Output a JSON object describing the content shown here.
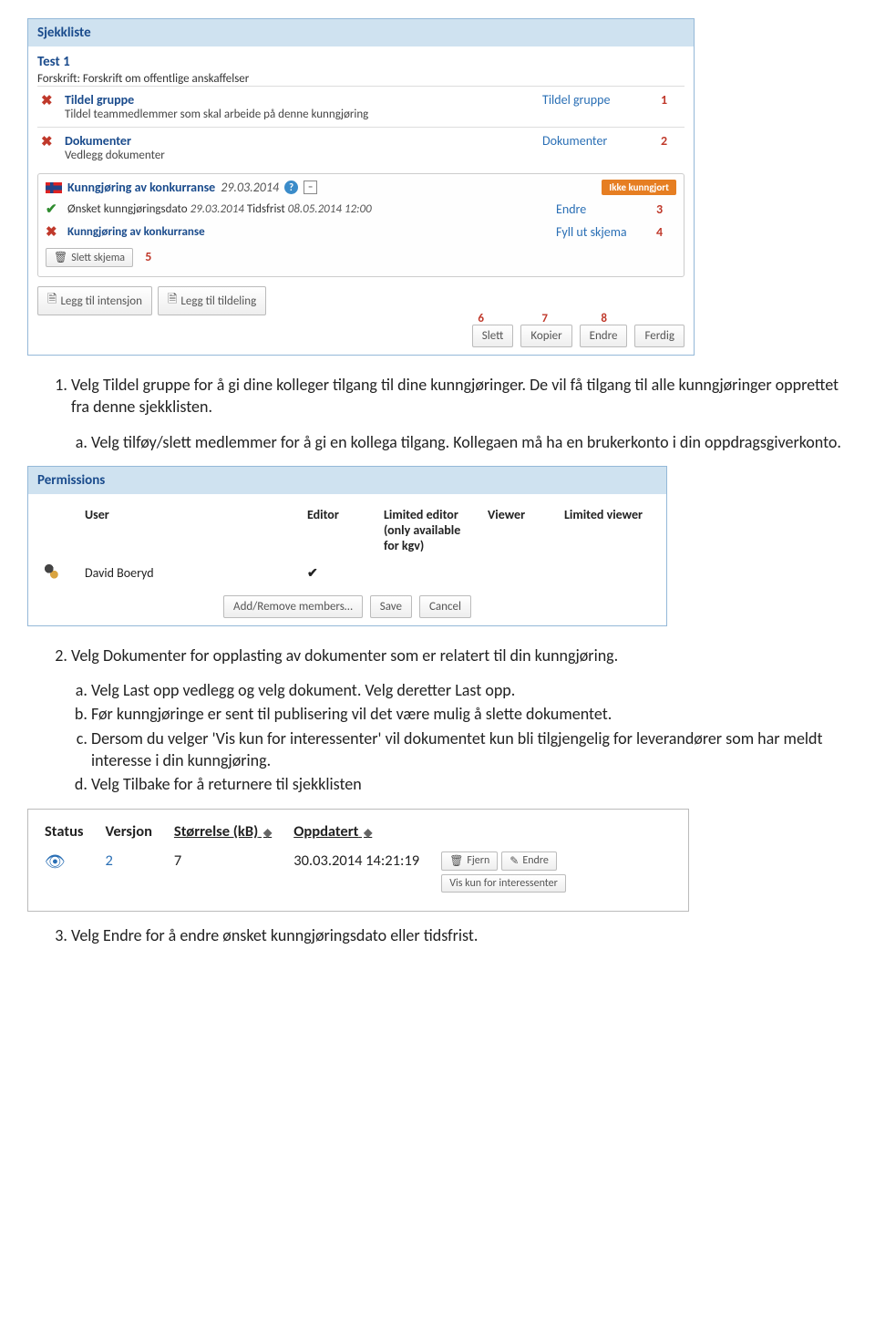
{
  "checklist": {
    "panel_title": "Sjekkliste",
    "test_title": "Test 1",
    "forskrift": "Forskrift: Forskrift om offentlige anskaffelser",
    "rows": [
      {
        "status": "x",
        "title": "Tildel gruppe",
        "desc": "Tildel teammedlemmer som skal arbeide på denne kunngjøring",
        "link": "Tildel gruppe",
        "num": "1"
      },
      {
        "status": "x",
        "title": "Dokumenter",
        "desc": "Vedlegg dokumenter",
        "link": "Dokumenter",
        "num": "2"
      }
    ],
    "kunn": {
      "title": "Kunngjøring av konkurranse",
      "date": "29.03.2014",
      "badge": "Ikke kunngjort",
      "row1_label": "Ønsket kunngjøringsdato",
      "row1_date": "29.03.2014",
      "row1_tid_label": "Tidsfrist",
      "row1_tid": "08.05.2014 12:00",
      "row1_action": "Endre",
      "row1_num": "3",
      "row2_title": "Kunngjøring av konkurranse",
      "row2_action": "Fyll ut skjema",
      "row2_num": "4",
      "slett_btn": "Slett skjema",
      "slett_num": "5"
    },
    "intensjon_btn": "Legg til intensjon",
    "tildeling_btn": "Legg til tildeling",
    "action_nums": {
      "n6": "6",
      "n7": "7",
      "n8": "8"
    },
    "actions": {
      "slett": "Slett",
      "kopier": "Kopier",
      "endre": "Endre",
      "ferdig": "Ferdig"
    }
  },
  "instructions1": {
    "p1": "Velg Tildel gruppe for å gi dine kolleger tilgang til dine kunngjøringer. De vil få tilgang til alle kunngjøringer opprettet fra denne sjekklisten.",
    "a": "Velg tilføy/slett medlemmer for å gi en kollega tilgang. Kollegaen må ha en brukerkonto i din oppdragsgiverkonto."
  },
  "permissions": {
    "panel_title": "Permissions",
    "headers": {
      "user": "User",
      "editor": "Editor",
      "limited_editor": "Limited editor (only available for kgv)",
      "viewer": "Viewer",
      "limited_viewer": "Limited viewer"
    },
    "user_name": "David Boeryd",
    "buttons": {
      "add": "Add/Remove members…",
      "save": "Save",
      "cancel": "Cancel"
    }
  },
  "instructions2": {
    "p2": "Velg Dokumenter for opplasting av dokumenter som er relatert til din kunngjøring.",
    "a": "Velg Last opp vedlegg og velg dokument. Velg deretter Last opp.",
    "b": "Før kunngjøringe er sent til publisering vil det være mulig å slette dokumentet.",
    "c": "Dersom du velger 'Vis kun for interessenter' vil dokumentet kun bli tilgjengelig for leverandører som har meldt interesse i din kunngjøring.",
    "d": "Velg Tilbake for å returnere til sjekklisten"
  },
  "status_table": {
    "headers": {
      "status": "Status",
      "versjon": "Versjon",
      "storrelse": "Størrelse (kB)",
      "oppdatert": "Oppdatert"
    },
    "row": {
      "versjon": "2",
      "kb": "7",
      "oppdatert": "30.03.2014 14:21:19"
    },
    "buttons": {
      "fjern": "Fjern",
      "endre": "Endre",
      "vis": "Vis kun for interessenter"
    }
  },
  "instructions3": {
    "p3": "Velg Endre for å endre ønsket kunngjøringsdato eller tidsfrist."
  }
}
